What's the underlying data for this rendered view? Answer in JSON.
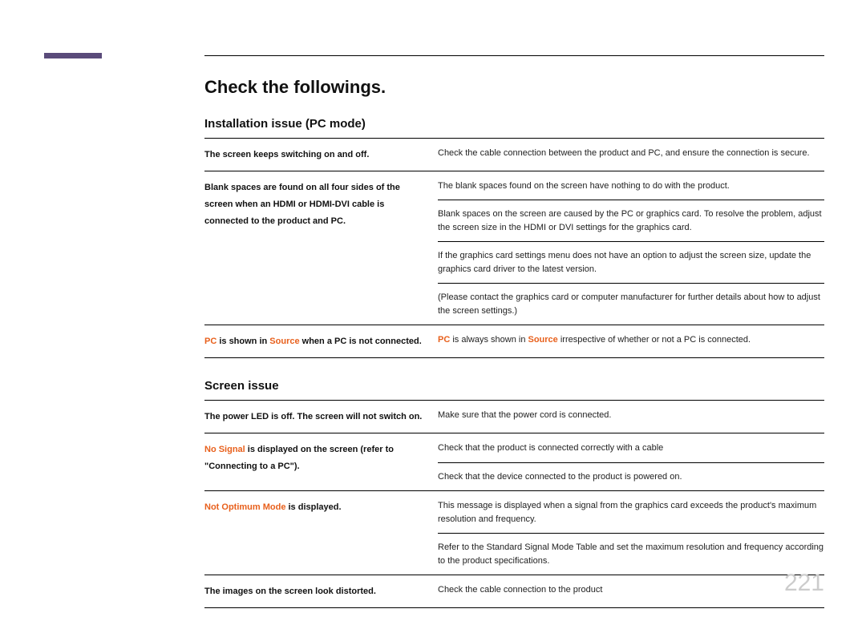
{
  "pageNumber": "221",
  "mainTitle": "Check the followings.",
  "sections": [
    {
      "title": "Installation issue (PC mode)",
      "rows": [
        {
          "issueSegments": [
            {
              "text": "The screen keeps switching on and off.",
              "highlight": false
            }
          ],
          "solutions": [
            "Check the cable connection between the product and PC, and ensure the connection is secure."
          ]
        },
        {
          "issueSegments": [
            {
              "text": "Blank spaces are found on all four sides of the screen when an HDMI or HDMI-DVI cable is connected to the product and PC.",
              "highlight": false
            }
          ],
          "solutions": [
            "The blank spaces found on the screen have nothing to do with the product.",
            "Blank spaces on the screen are caused by the PC or graphics card. To resolve the problem, adjust the screen size in the HDMI or DVI settings for the graphics card.",
            "If the graphics card settings menu does not have an option to adjust the screen size, update the graphics card driver to the latest version.",
            "(Please contact the graphics card or computer manufacturer for further details about how to adjust the screen settings.)"
          ]
        },
        {
          "issueSegments": [
            {
              "text": "PC",
              "highlight": true
            },
            {
              "text": " is shown in ",
              "highlight": false
            },
            {
              "text": "Source",
              "highlight": true
            },
            {
              "text": " when a PC is not connected.",
              "highlight": false
            }
          ],
          "solutionSegments": [
            [
              {
                "text": "PC",
                "highlight": true
              },
              {
                "text": " is always shown in ",
                "highlight": false
              },
              {
                "text": "Source",
                "highlight": true
              },
              {
                "text": " irrespective of whether or not a PC is connected.",
                "highlight": false
              }
            ]
          ]
        }
      ]
    },
    {
      "title": "Screen issue",
      "rows": [
        {
          "issueSegments": [
            {
              "text": "The power LED is off. The screen will not switch on.",
              "highlight": false
            }
          ],
          "solutions": [
            "Make sure that the power cord is connected."
          ]
        },
        {
          "issueSegments": [
            {
              "text": "No Signal",
              "highlight": true
            },
            {
              "text": " is displayed on the screen (refer to \"Connecting to a PC\").",
              "highlight": false
            }
          ],
          "solutions": [
            "Check that the product is connected correctly with a cable",
            "Check that the device connected to the product is powered on."
          ]
        },
        {
          "issueSegments": [
            {
              "text": "Not Optimum Mode",
              "highlight": true
            },
            {
              "text": " is displayed.",
              "highlight": false
            }
          ],
          "solutions": [
            "This message is displayed when a signal from the graphics card exceeds the product's maximum resolution and frequency.",
            "Refer to the Standard Signal Mode Table and set the maximum resolution and frequency according to the product specifications."
          ]
        },
        {
          "issueSegments": [
            {
              "text": "The images on the screen look distorted.",
              "highlight": false
            }
          ],
          "solutions": [
            "Check the cable connection to the product"
          ]
        }
      ]
    }
  ]
}
